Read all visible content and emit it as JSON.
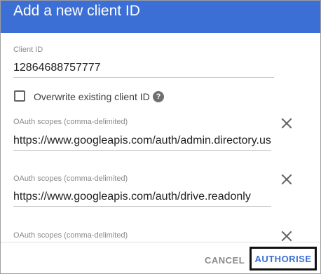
{
  "dialog": {
    "title": "Add a new client ID",
    "client_id": {
      "label": "Client ID",
      "value": "12864688757777"
    },
    "overwrite": {
      "label": "Overwrite existing client ID",
      "checked": false,
      "help_icon": "?"
    },
    "scopes": [
      {
        "label": "OAuth scopes (comma-delimited)",
        "value": "https://www.googleapis.com/auth/admin.directory.user"
      },
      {
        "label": "OAuth scopes (comma-delimited)",
        "value": "https://www.googleapis.com/auth/drive.readonly"
      },
      {
        "label": "OAuth scopes (comma-delimited)",
        "value": ""
      }
    ],
    "icons": {
      "remove": "close-icon",
      "help": "help-circle-icon"
    },
    "actions": {
      "cancel": "CANCEL",
      "authorise": "AUTHORISE"
    },
    "colors": {
      "header": "#3b6fd6",
      "primary_button_text": "#3b6fd6",
      "cancel_text": "#8a8a8a"
    }
  }
}
